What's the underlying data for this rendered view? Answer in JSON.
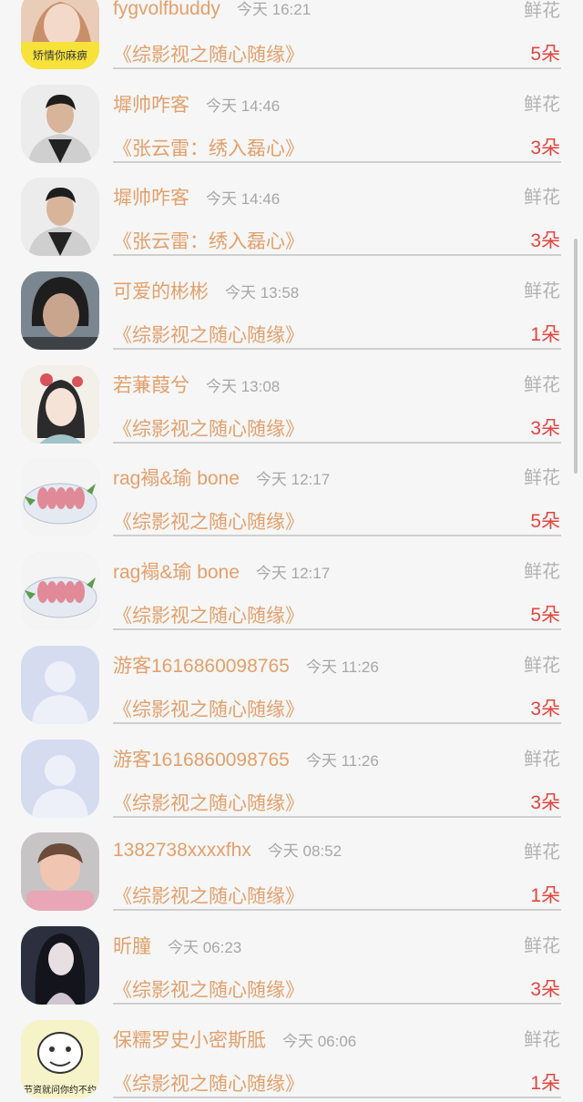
{
  "rows": [
    {
      "name": "fygvolfbuddy",
      "time": "今天 16:21",
      "gift": "鲜花",
      "work": "《综影视之随心随缘》",
      "count": "5朵",
      "avatar": "girl-photo",
      "avatar_caption": "矫情你麻痹"
    },
    {
      "name": "墀帅咋客",
      "time": "今天 14:46",
      "gift": "鲜花",
      "work": "《张云雷：绣入磊心》",
      "count": "3朵",
      "avatar": "man-photo"
    },
    {
      "name": "墀帅咋客",
      "time": "今天 14:46",
      "gift": "鲜花",
      "work": "《张云雷：绣入磊心》",
      "count": "3朵",
      "avatar": "man-photo"
    },
    {
      "name": "可爱的彬彬",
      "time": "今天 13:58",
      "gift": "鲜花",
      "work": "《综影视之随心随缘》",
      "count": "1朵",
      "avatar": "selfie-photo"
    },
    {
      "name": "若蒹葭兮",
      "time": "今天 13:08",
      "gift": "鲜花",
      "work": "《综影视之随心随缘》",
      "count": "3朵",
      "avatar": "painted-girl"
    },
    {
      "name": "rag褟&瑜 bone",
      "time": "今天 12:17",
      "gift": "鲜花",
      "work": "《综影视之随心随缘》",
      "count": "5朵",
      "avatar": "sashimi-plate"
    },
    {
      "name": "rag褟&瑜 bone",
      "time": "今天 12:17",
      "gift": "鲜花",
      "work": "《综影视之随心随缘》",
      "count": "5朵",
      "avatar": "sashimi-plate"
    },
    {
      "name": "游客1616860098765",
      "time": "今天 11:26",
      "gift": "鲜花",
      "work": "《综影视之随心随缘》",
      "count": "3朵",
      "avatar": "default-avatar"
    },
    {
      "name": "游客1616860098765",
      "time": "今天 11:26",
      "gift": "鲜花",
      "work": "《综影视之随心随缘》",
      "count": "3朵",
      "avatar": "default-avatar"
    },
    {
      "name": "1382738xxxxfhx",
      "time": "今天 08:52",
      "gift": "鲜花",
      "work": "《综影视之随心随缘》",
      "count": "1朵",
      "avatar": "baby-photo"
    },
    {
      "name": "昕朣",
      "time": "今天 06:23",
      "gift": "鲜花",
      "work": "《综影视之随心随缘》",
      "count": "3朵",
      "avatar": "anime-girl"
    },
    {
      "name": "保糯罗史小密斯胝",
      "time": "今天 06:06",
      "gift": "鲜花",
      "work": "《综影视之随心随缘》",
      "count": "1朵",
      "avatar": "meme-face",
      "avatar_caption": "节资就问你约不约"
    }
  ]
}
